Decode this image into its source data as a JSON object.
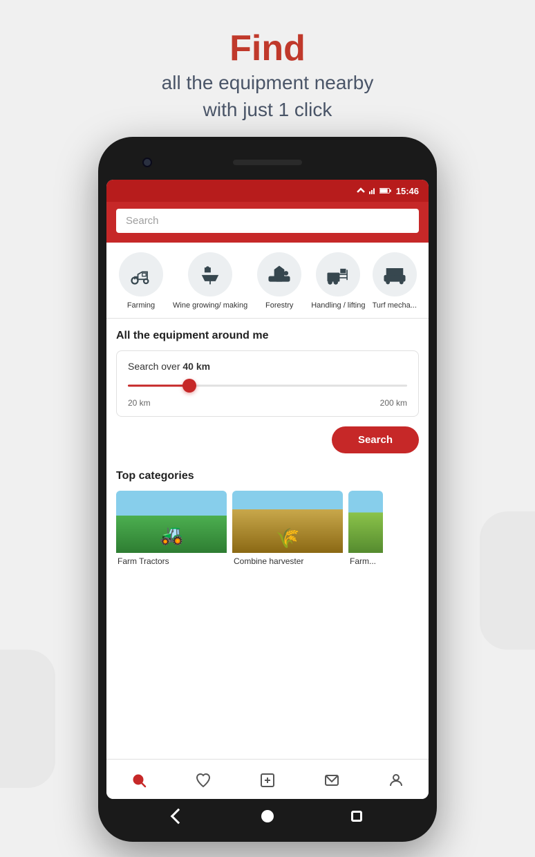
{
  "header": {
    "find_label": "Find",
    "subtitle_line1": "all the equipment nearby",
    "subtitle_line2": "with just 1 click"
  },
  "status_bar": {
    "time": "15:46"
  },
  "app": {
    "search_placeholder": "Search",
    "categories": [
      {
        "id": "farming",
        "label": "Farming"
      },
      {
        "id": "wine-growing",
        "label": "Wine growing/ making"
      },
      {
        "id": "forestry",
        "label": "Forestry"
      },
      {
        "id": "handling",
        "label": "Handling / lifting"
      },
      {
        "id": "turf",
        "label": "Turf mecha..."
      }
    ],
    "equipment_section_title": "All the equipment around me",
    "range_prefix": "Search over",
    "range_value": "40",
    "range_unit": "km",
    "range_min": "20 km",
    "range_max": "200 km",
    "search_button_label": "Search",
    "top_categories_title": "Top categories",
    "top_categories": [
      {
        "id": "farm-tractors",
        "label": "Farm Tractors"
      },
      {
        "id": "combine-harvester",
        "label": "Combine harvester"
      },
      {
        "id": "farm3",
        "label": "Farm..."
      }
    ]
  },
  "bottom_nav": {
    "items": [
      {
        "id": "search",
        "label": "Search",
        "active": true
      },
      {
        "id": "favorites",
        "label": "Favorites",
        "active": false
      },
      {
        "id": "post",
        "label": "Post",
        "active": false
      },
      {
        "id": "messages",
        "label": "Messages",
        "active": false
      },
      {
        "id": "profile",
        "label": "Profile",
        "active": false
      }
    ]
  }
}
